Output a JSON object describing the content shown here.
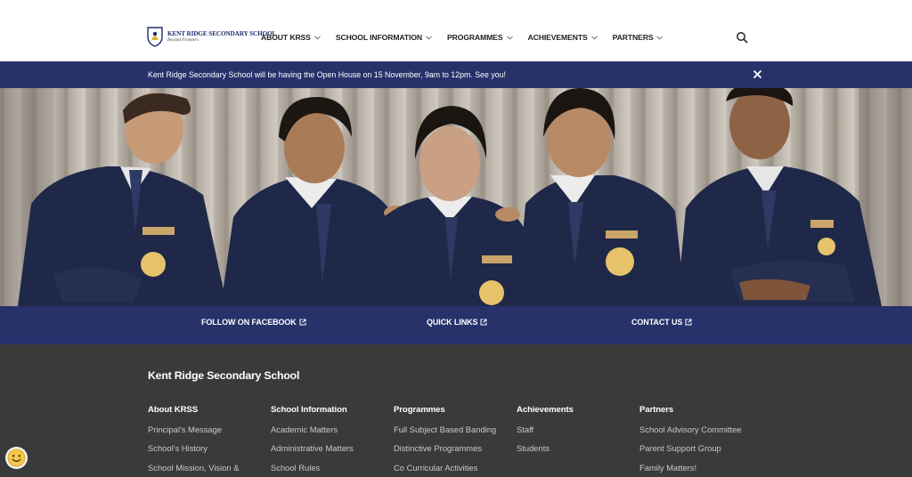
{
  "header": {
    "logo_name": "KENT RIDGE SECONDARY SCHOOL",
    "logo_tagline": "Beyond Frontiers",
    "nav": [
      {
        "label": "ABOUT KRSS"
      },
      {
        "label": "SCHOOL INFORMATION"
      },
      {
        "label": "PROGRAMMES"
      },
      {
        "label": "ACHIEVEMENTS"
      },
      {
        "label": "PARTNERS"
      }
    ]
  },
  "announcement": {
    "text": "Kent Ridge Secondary School will be having the Open House on 15 November, 9am to 12pm. See you!"
  },
  "quick_links": [
    {
      "label": "FOLLOW ON FACEBOOK"
    },
    {
      "label": "QUICK LINKS"
    },
    {
      "label": "CONTACT US"
    }
  ],
  "footer": {
    "title": "Kent Ridge Secondary School",
    "columns": [
      {
        "heading": "About KRSS",
        "links": [
          "Principal's Message",
          "School's History",
          "School Mission, Vision &"
        ]
      },
      {
        "heading": "School Information",
        "links": [
          "Academic Matters",
          "Administrative Matters",
          "School Rules"
        ]
      },
      {
        "heading": "Programmes",
        "links": [
          "Full Subject Based Banding",
          "Distinctive Programmes",
          "Co Curricular Activities"
        ]
      },
      {
        "heading": "Achievements",
        "links": [
          "Staff",
          "Students"
        ]
      },
      {
        "heading": "Partners",
        "links": [
          "School Advisory Committee",
          "Parent Support Group",
          "Family Matters!"
        ]
      }
    ]
  },
  "colors": {
    "brand_navy": "#27316a",
    "footer_bg": "#3a3a3a"
  },
  "icons": {
    "search": "search-icon",
    "close": "close-icon",
    "chevron": "chevron-down-icon",
    "external": "external-link-icon",
    "chat": "smiley-icon"
  }
}
